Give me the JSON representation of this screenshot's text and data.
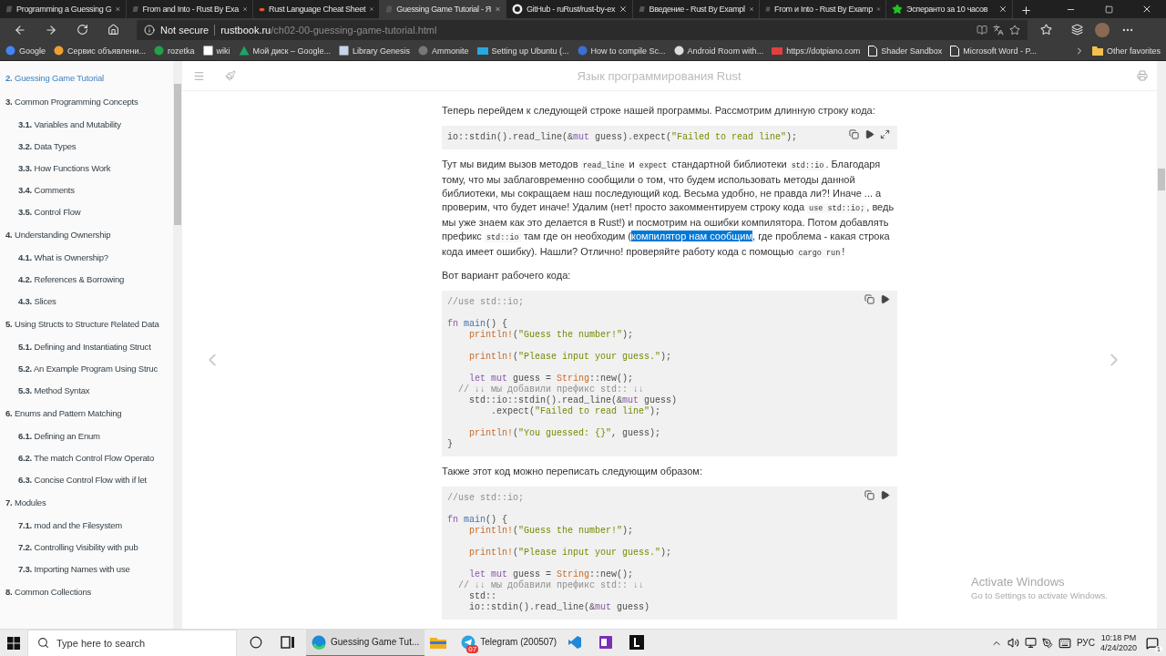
{
  "browser": {
    "tabs": [
      {
        "title": "Programming a Guessing G",
        "kind": "book",
        "selected": false
      },
      {
        "title": "From and Into - Rust By Exa",
        "kind": "book",
        "selected": false
      },
      {
        "title": "Rust Language Cheat Sheet",
        "kind": "crab",
        "selected": false
      },
      {
        "title": "Guessing Game Tutorial - Я",
        "kind": "book",
        "selected": true
      },
      {
        "title": "GitHub - ruRust/rust-by-ex",
        "kind": "github",
        "selected": false
      },
      {
        "title": "Введение - Rust By Exampl",
        "kind": "book",
        "selected": false
      },
      {
        "title": "From и Into - Rust By Examp",
        "kind": "book",
        "selected": false
      },
      {
        "title": "Эсперанто за 10 часов",
        "kind": "star",
        "selected": false
      }
    ],
    "address_bar": {
      "security": "Not secure",
      "domain": "rustbook.ru",
      "path": "/ch02-00-guessing-game-tutorial.html"
    },
    "bookmarks": [
      {
        "label": "Google",
        "kind": "circle",
        "color": "#4285f4"
      },
      {
        "label": "Сервис объявлени...",
        "kind": "circle",
        "color": "#f0a030"
      },
      {
        "label": "rozetka",
        "kind": "circle",
        "color": "#23a048"
      },
      {
        "label": "wiki",
        "kind": "square",
        "color": "#ffffff"
      },
      {
        "label": "Мой диск – Google...",
        "kind": "triangle",
        "color": "#1fa463"
      },
      {
        "label": "Library Genesis",
        "kind": "square",
        "color": "#c8d4e8"
      },
      {
        "label": "Ammonite",
        "kind": "circle",
        "color": "#777777"
      },
      {
        "label": "Setting up Ubuntu (...",
        "kind": "bar",
        "color": "#29a8e0"
      },
      {
        "label": "How to compile Sc...",
        "kind": "circle",
        "color": "#3b6fd6"
      },
      {
        "label": "Android Room with...",
        "kind": "circle",
        "color": "#dddddd"
      },
      {
        "label": "https://dotpiano.com",
        "kind": "bar",
        "color": "#e04040"
      },
      {
        "label": "Shader Sandbox",
        "kind": "page",
        "color": "#ffffff"
      },
      {
        "label": "Microsoft Word - P...",
        "kind": "page",
        "color": "#ffffff"
      }
    ],
    "other_favorites": "Other favorites"
  },
  "sidebar": {
    "items": [
      {
        "number": "2.",
        "title": "Guessing Game Tutorial",
        "selected": true
      },
      {
        "number": "3.",
        "title": "Common Programming Concepts",
        "selected": false,
        "children": [
          {
            "number": "3.1.",
            "title": "Variables and Mutability",
            "selected": false
          },
          {
            "number": "3.2.",
            "title": "Data Types",
            "selected": false
          },
          {
            "number": "3.3.",
            "title": "How Functions Work",
            "selected": false
          },
          {
            "number": "3.4.",
            "title": "Comments",
            "selected": false
          },
          {
            "number": "3.5.",
            "title": "Control Flow",
            "selected": false
          }
        ]
      },
      {
        "number": "4.",
        "title": "Understanding Ownership",
        "selected": false,
        "children": [
          {
            "number": "4.1.",
            "title": "What is Ownership?",
            "selected": false
          },
          {
            "number": "4.2.",
            "title": "References & Borrowing",
            "selected": false
          },
          {
            "number": "4.3.",
            "title": "Slices",
            "selected": false
          }
        ]
      },
      {
        "number": "5.",
        "title": "Using Structs to Structure Related Data",
        "selected": false,
        "children": [
          {
            "number": "5.1.",
            "title": "Defining and Instantiating Struct",
            "selected": false
          },
          {
            "number": "5.2.",
            "title": "An Example Program Using Struc",
            "selected": false
          },
          {
            "number": "5.3.",
            "title": "Method Syntax",
            "selected": false
          }
        ]
      },
      {
        "number": "6.",
        "title": "Enums and Pattern Matching",
        "selected": false,
        "children": [
          {
            "number": "6.1.",
            "title": "Defining an Enum",
            "selected": false
          },
          {
            "number": "6.2.",
            "title": "The match Control Flow Operato",
            "selected": false
          },
          {
            "number": "6.3.",
            "title": "Concise Control Flow with if let",
            "selected": false
          }
        ]
      },
      {
        "number": "7.",
        "title": "Modules",
        "selected": false,
        "children": [
          {
            "number": "7.1.",
            "title": "mod and the Filesystem",
            "selected": false
          },
          {
            "number": "7.2.",
            "title": "Controlling Visibility with pub",
            "selected": false
          },
          {
            "number": "7.3.",
            "title": "Importing Names with use",
            "selected": false
          }
        ]
      },
      {
        "number": "8.",
        "title": "Common Collections",
        "selected": false
      }
    ]
  },
  "page": {
    "title": "Язык программирования Rust",
    "content": [
      {
        "kind": "paragraph",
        "segments": [
          "Теперь перейдем к следующей строке нашей программы. Рассмотрим длинную строку кода:"
        ]
      },
      {
        "kind": "code",
        "expandable": true,
        "lines": [
          {
            "segments": [
              "io::stdin().read_line(&",
              {
                "text": "mut",
                "kind": "keyword"
              },
              " guess).expect(",
              {
                "text": "\"Failed to read line\"",
                "kind": "string"
              },
              ");"
            ]
          }
        ]
      },
      {
        "kind": "paragraph",
        "segments": [
          "Тут мы видим вызов методов ",
          {
            "text": "read_line",
            "kind": "code"
          },
          " и ",
          {
            "text": "expect",
            "kind": "code"
          },
          " стандартной библиотеки ",
          {
            "text": "std::io",
            "kind": "code"
          },
          ". Благодаря тому, что мы заблаговременно сообщили о том, что будем использовать методы данной библиотеки, мы сокращаем наш последующий код. Весьма удобно, не правда ли?! Иначе ... а проверим, что будет иначе! Удалим (нет! просто закомментируем строку кода ",
          {
            "text": "use std::io;",
            "kind": "code"
          },
          ", ведь мы уже знаем как это делается в Rust!) и посмотрим на ошибки компилятора. Потом добавлять префикс ",
          {
            "text": "std::io",
            "kind": "code"
          },
          " там где он необходим (",
          {
            "text": "компилятор нам сообщим",
            "kind": "selected"
          },
          ", где проблема - какая строка кода имеет ошибку). Нашли? Отлично! проверяйте работу кода с помощью ",
          {
            "text": "cargo run",
            "kind": "code"
          },
          "!"
        ]
      },
      {
        "kind": "paragraph",
        "segments": [
          "Вот вариант рабочего кода:"
        ]
      },
      {
        "kind": "code",
        "expandable": false,
        "lines": [
          {
            "segments": [
              {
                "text": "//use std::io;",
                "kind": "comment"
              }
            ]
          },
          {
            "kind": "blank"
          },
          {
            "segments": [
              {
                "text": "fn ",
                "kind": "keyword"
              },
              {
                "text": "main",
                "kind": "function"
              },
              "() {"
            ]
          },
          {
            "segments": [
              {
                "text": "    println!",
                "kind": "macro"
              },
              "(",
              {
                "text": "\"Guess the number!\"",
                "kind": "string"
              },
              ");"
            ]
          },
          {
            "kind": "blank"
          },
          {
            "segments": [
              {
                "text": "    println!",
                "kind": "macro"
              },
              "(",
              {
                "text": "\"Please input your guess.\"",
                "kind": "string"
              },
              ");"
            ]
          },
          {
            "kind": "blank"
          },
          {
            "segments": [
              {
                "text": "    let mut",
                "kind": "keyword"
              },
              " guess = ",
              {
                "text": "String",
                "kind": "macro"
              },
              "::new();"
            ]
          },
          {
            "segments": [
              {
                "text": "  // ↓↓ мы добавили префикс std:: ↓↓",
                "kind": "comment"
              }
            ]
          },
          {
            "segments": [
              "    std::io::stdin().read_line(&",
              {
                "text": "mut",
                "kind": "keyword"
              },
              " guess)"
            ]
          },
          {
            "segments": [
              "        .expect(",
              {
                "text": "\"Failed to read line\"",
                "kind": "string"
              },
              ");"
            ]
          },
          {
            "kind": "blank"
          },
          {
            "segments": [
              {
                "text": "    println!",
                "kind": "macro"
              },
              "(",
              {
                "text": "\"You guessed: {}\"",
                "kind": "string"
              },
              ", guess);"
            ]
          },
          {
            "segments": [
              "}"
            ]
          }
        ]
      },
      {
        "kind": "paragraph",
        "segments": [
          "Также этот код можно переписать следующим образом:"
        ]
      },
      {
        "kind": "code",
        "expandable": false,
        "lines": [
          {
            "segments": [
              {
                "text": "//use std::io;",
                "kind": "comment"
              }
            ]
          },
          {
            "kind": "blank"
          },
          {
            "segments": [
              {
                "text": "fn ",
                "kind": "keyword"
              },
              {
                "text": "main",
                "kind": "function"
              },
              "() {"
            ]
          },
          {
            "segments": [
              {
                "text": "    println!",
                "kind": "macro"
              },
              "(",
              {
                "text": "\"Guess the number!\"",
                "kind": "string"
              },
              ");"
            ]
          },
          {
            "kind": "blank"
          },
          {
            "segments": [
              {
                "text": "    println!",
                "kind": "macro"
              },
              "(",
              {
                "text": "\"Please input your guess.\"",
                "kind": "string"
              },
              ");"
            ]
          },
          {
            "kind": "blank"
          },
          {
            "segments": [
              {
                "text": "    let mut",
                "kind": "keyword"
              },
              " guess = ",
              {
                "text": "String",
                "kind": "macro"
              },
              "::new();"
            ]
          },
          {
            "segments": [
              {
                "text": "  // ↓↓ мы добавили префикс std:: ↓↓",
                "kind": "comment"
              }
            ]
          },
          {
            "segments": [
              "    std::"
            ]
          },
          {
            "segments": [
              "    io::stdin().read_line(&",
              {
                "text": "mut",
                "kind": "keyword"
              },
              " guess)"
            ]
          }
        ]
      }
    ]
  },
  "activation_notice": {
    "title": "Activate Windows",
    "subtitle": "Go to Settings to activate Windows."
  },
  "taskbar": {
    "search_placeholder": "Type here to search",
    "apps": [
      {
        "kind": "edge",
        "label": "Guessing Game Tut...",
        "selected": true
      },
      {
        "kind": "explorer",
        "selected": false
      },
      {
        "kind": "telegram",
        "label": "Telegram (200507)",
        "badge": "07",
        "selected": false
      },
      {
        "kind": "vscode",
        "selected": false
      },
      {
        "kind": "onenote",
        "selected": false
      },
      {
        "kind": "l-app",
        "selected": false
      }
    ],
    "language": "РУС",
    "time": "10:18 PM",
    "date": "4/24/2020",
    "notifications": "1"
  }
}
